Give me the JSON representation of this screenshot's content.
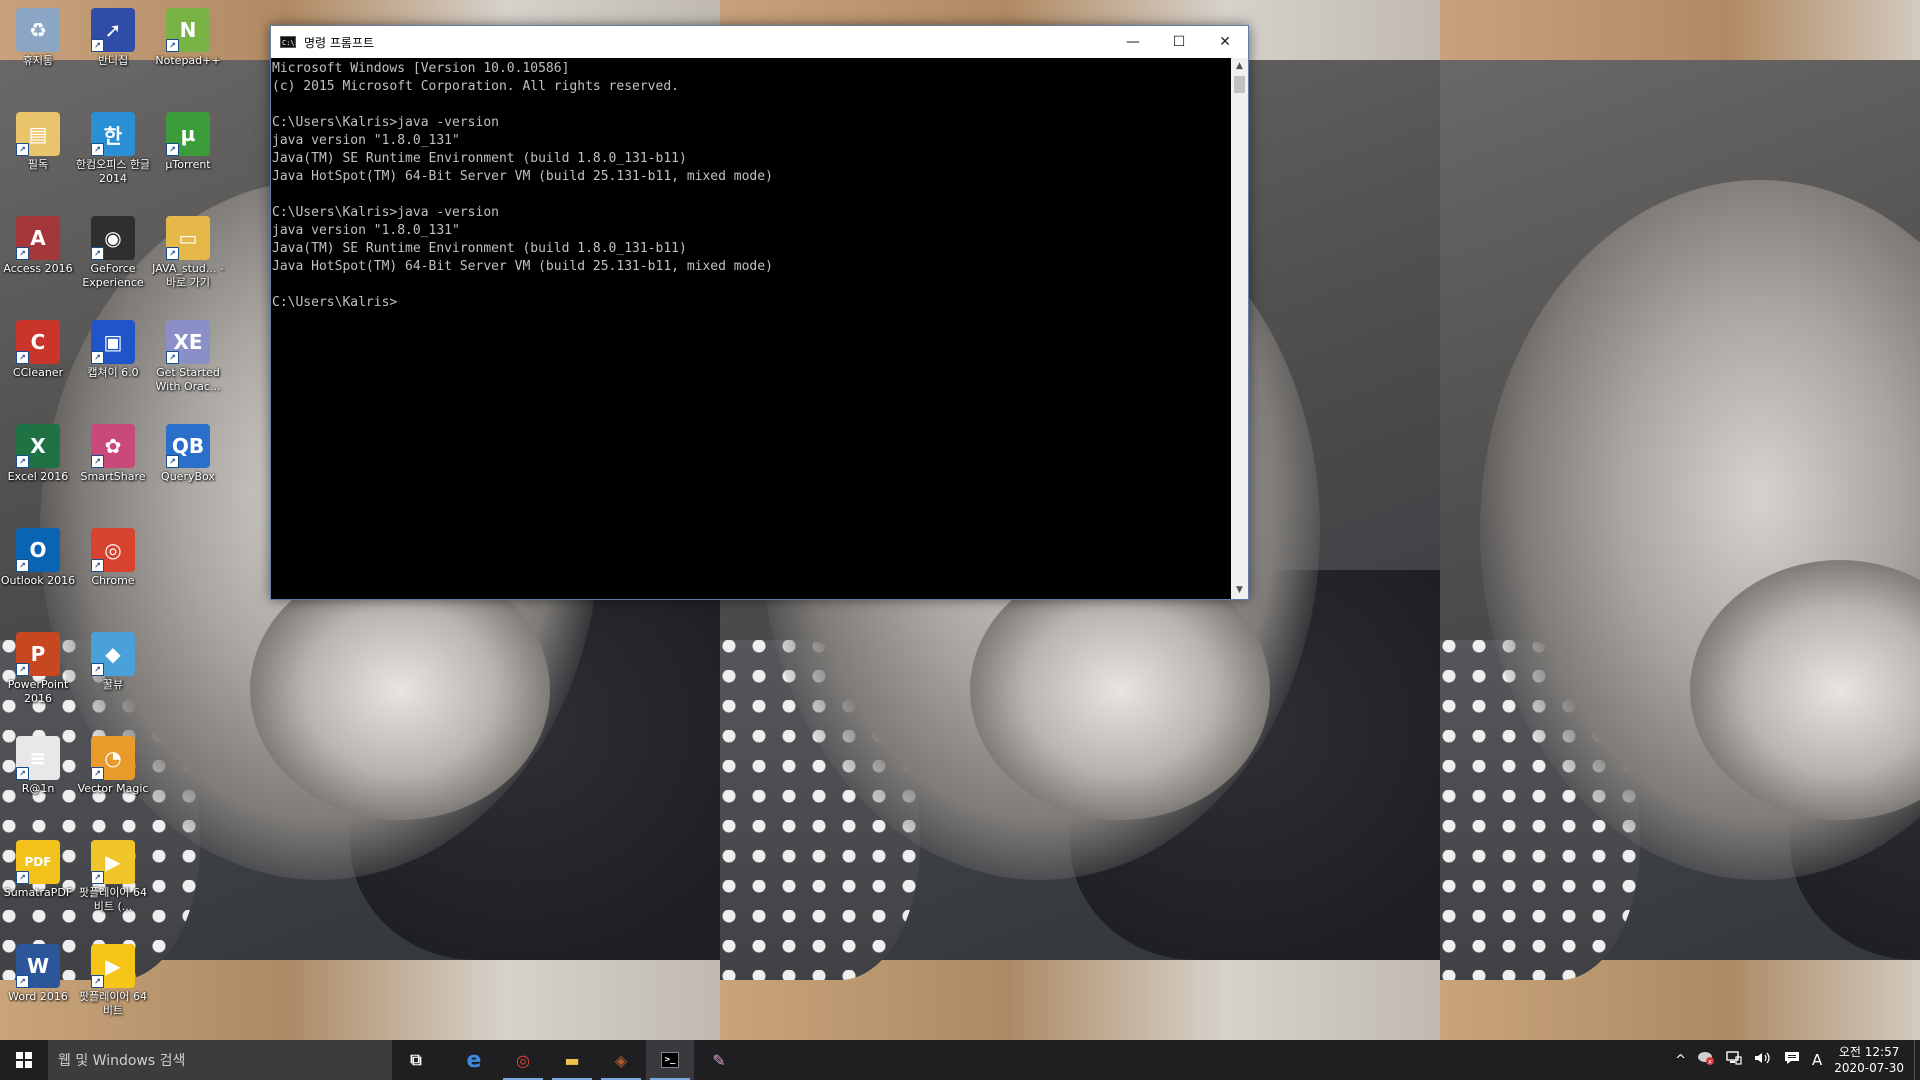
{
  "desktop": {
    "icons": [
      {
        "label": "휴지통",
        "icon": "recycle-bin-icon",
        "color": "#8aa6c4",
        "glyph": "♻"
      },
      {
        "label": "반디집",
        "icon": "bandizip-icon",
        "color": "#2f4da8",
        "glyph": "➚"
      },
      {
        "label": "Notepad++",
        "icon": "notepadpp-icon",
        "color": "#79b346",
        "glyph": "N"
      },
      {
        "label": "필독",
        "icon": "folder-doc-icon",
        "color": "#e9c46a",
        "glyph": "▤"
      },
      {
        "label": "한컴오피스 한글 2014",
        "icon": "hancom-icon",
        "color": "#2b8fd6",
        "glyph": "한"
      },
      {
        "label": "µTorrent",
        "icon": "utorrent-icon",
        "color": "#3a9d3a",
        "glyph": "µ"
      },
      {
        "label": "Access 2016",
        "icon": "access-icon",
        "color": "#a4373a",
        "glyph": "A"
      },
      {
        "label": "GeForce Experience",
        "icon": "geforce-icon",
        "color": "#2f2f2f",
        "glyph": "◉"
      },
      {
        "label": "JAVA_stud... - 바로 가기",
        "icon": "folder-icon",
        "color": "#e6b84a",
        "glyph": "▭"
      },
      {
        "label": "CCleaner",
        "icon": "ccleaner-icon",
        "color": "#c9352b",
        "glyph": "C"
      },
      {
        "label": "캡쳐이 6.0",
        "icon": "capture-icon",
        "color": "#1f55c9",
        "glyph": "▣"
      },
      {
        "label": "Get Started With Orac...",
        "icon": "oracle-xe-icon",
        "color": "#8a8fc7",
        "glyph": "XE"
      },
      {
        "label": "Excel 2016",
        "icon": "excel-icon",
        "color": "#1f7244",
        "glyph": "X"
      },
      {
        "label": "SmartShare",
        "icon": "smartshare-icon",
        "color": "#c94a7a",
        "glyph": "✿"
      },
      {
        "label": "QueryBox",
        "icon": "querybox-icon",
        "color": "#2a6fc9",
        "glyph": "QB"
      },
      {
        "label": "Outlook 2016",
        "icon": "outlook-icon",
        "color": "#0a64b4",
        "glyph": "O"
      },
      {
        "label": "Chrome",
        "icon": "chrome-icon",
        "color": "#d7432f",
        "glyph": "◎"
      },
      {
        "label": "",
        "icon": "",
        "color": "",
        "glyph": ""
      },
      {
        "label": "PowerPoint 2016",
        "icon": "powerpoint-icon",
        "color": "#c8471e",
        "glyph": "P"
      },
      {
        "label": "꿀뷰",
        "icon": "honeyview-icon",
        "color": "#4aa0d8",
        "glyph": "◆"
      },
      {
        "label": "",
        "icon": "",
        "color": "",
        "glyph": ""
      },
      {
        "label": "R@1n",
        "icon": "text-file-icon",
        "color": "#e8e8e8",
        "glyph": "≡"
      },
      {
        "label": "Vector Magic",
        "icon": "vector-magic-icon",
        "color": "#e89a2a",
        "glyph": "◔"
      },
      {
        "label": "",
        "icon": "",
        "color": "",
        "glyph": ""
      },
      {
        "label": "SumatraPDF",
        "icon": "sumatrapdf-icon",
        "color": "#f2c21a",
        "glyph": "PDF"
      },
      {
        "label": "팟플레이어 64 비트 (...",
        "icon": "potplayer-icon",
        "color": "#f0c52a",
        "glyph": "▶"
      },
      {
        "label": "",
        "icon": "",
        "color": "",
        "glyph": ""
      },
      {
        "label": "Word 2016",
        "icon": "word-icon",
        "color": "#2b579a",
        "glyph": "W"
      },
      {
        "label": "팟플레이어 64 비트",
        "icon": "potplayer-icon",
        "color": "#f5c518",
        "glyph": "▶"
      }
    ]
  },
  "cmd_window": {
    "title": "명령 프롬프트",
    "minimize_glyph": "—",
    "maximize_glyph": "☐",
    "close_glyph": "✕",
    "lines": [
      "Microsoft Windows [Version 10.0.10586]",
      "(c) 2015 Microsoft Corporation. All rights reserved.",
      "",
      "C:\\Users\\Kalris>java -version",
      "java version \"1.8.0_131\"",
      "Java(TM) SE Runtime Environment (build 1.8.0_131-b11)",
      "Java HotSpot(TM) 64-Bit Server VM (build 25.131-b11, mixed mode)",
      "",
      "C:\\Users\\Kalris>java -version",
      "java version \"1.8.0_131\"",
      "Java(TM) SE Runtime Environment (build 1.8.0_131-b11)",
      "Java HotSpot(TM) 64-Bit Server VM (build 25.131-b11, mixed mode)",
      "",
      "C:\\Users\\Kalris>"
    ],
    "scroll_up_glyph": "▲",
    "scroll_down_glyph": "▼"
  },
  "taskbar": {
    "start_icon": "windows-logo-icon",
    "search_placeholder": "웹 및 Windows 검색",
    "apps": [
      {
        "name": "task-view",
        "icon": "task-view-icon",
        "glyph": "⧉",
        "color": "#ffffff",
        "running": false,
        "active": false
      },
      {
        "name": "internet-explorer",
        "icon": "internet-explorer-icon",
        "glyph": "e",
        "color": "#3c8ee0",
        "running": false,
        "active": false
      },
      {
        "name": "chrome",
        "icon": "chrome-icon",
        "glyph": "◎",
        "color": "#e0463a",
        "running": true,
        "active": false
      },
      {
        "name": "file-explorer",
        "icon": "folder-icon",
        "glyph": "▬",
        "color": "#f0c24a",
        "running": true,
        "active": false
      },
      {
        "name": "game-app",
        "icon": "game-icon",
        "glyph": "◈",
        "color": "#b25a2a",
        "running": true,
        "active": false
      },
      {
        "name": "command-prompt",
        "icon": "command-prompt-icon",
        "glyph": ">_",
        "color": "#ffffff",
        "running": true,
        "active": true
      },
      {
        "name": "pinned-app",
        "icon": "pinned-app-icon",
        "glyph": "✎",
        "color": "#d7a0c8",
        "running": false,
        "active": false
      }
    ],
    "tray": {
      "chevron": "^",
      "alert_icon": "security-alert-icon",
      "network_icon": "network-icon",
      "volume_icon": "volume-icon",
      "notification_icon": "notification-icon",
      "ime": "A",
      "time": "오전 12:57",
      "date": "2020-07-30"
    }
  }
}
